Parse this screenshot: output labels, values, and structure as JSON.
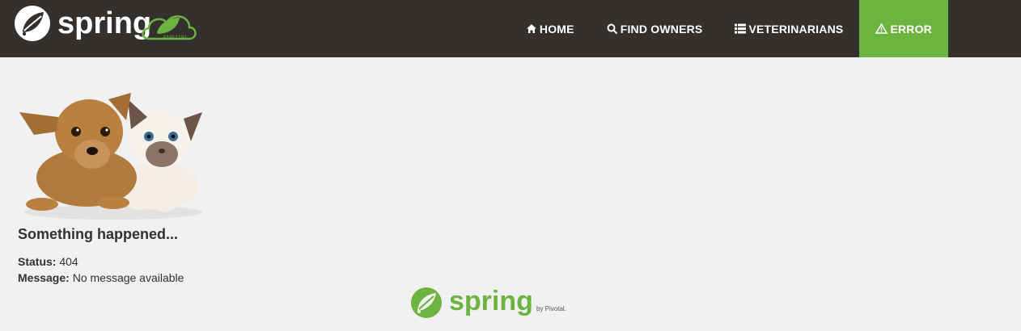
{
  "brand": {
    "logo_text": "spring",
    "badge_text": "01011101"
  },
  "nav": {
    "items": [
      {
        "label": "HOME",
        "icon": "home-icon"
      },
      {
        "label": "FIND OWNERS",
        "icon": "search-icon"
      },
      {
        "label": "VETERINARIANS",
        "icon": "list-icon"
      },
      {
        "label": "ERROR",
        "icon": "warning-icon",
        "active": true
      }
    ]
  },
  "main": {
    "image_alt": "pets",
    "title": "Something happened...",
    "status_label": "Status:",
    "status_value": "404",
    "message_label": "Message:",
    "message_value": "No message available"
  },
  "footer": {
    "logo_text": "spring",
    "byline": "by Pivotal."
  },
  "colors": {
    "nav_bg": "#34302d",
    "accent": "#6db33f",
    "page_bg": "#f1f1f1",
    "text": "#34302d"
  }
}
